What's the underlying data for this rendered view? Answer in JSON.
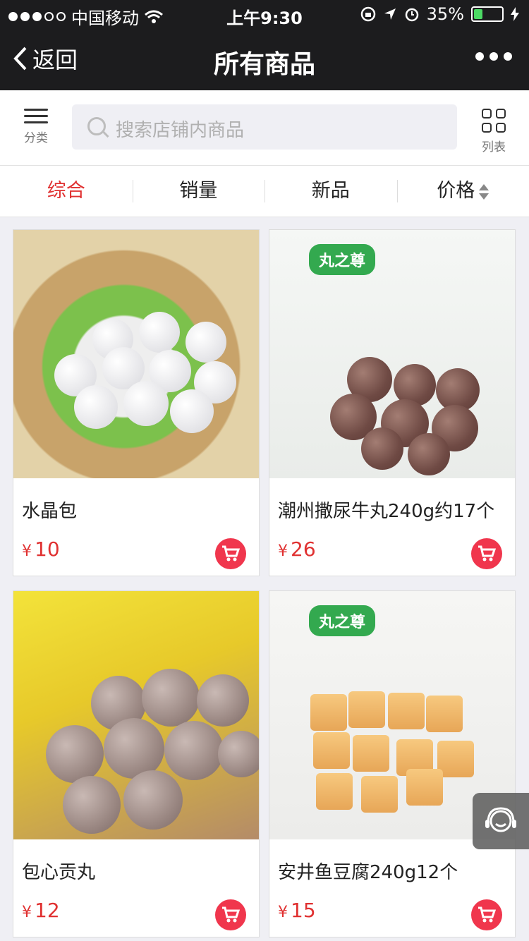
{
  "status_bar": {
    "carrier": "中国移动",
    "time": "上午9:30",
    "battery": "35%",
    "battery_level": 0.35
  },
  "nav": {
    "back_label": "返回",
    "title": "所有商品"
  },
  "toolbar": {
    "category_label": "分类",
    "search_placeholder": "搜索店铺内商品",
    "view_label": "列表"
  },
  "sort_tabs": [
    {
      "label": "综合",
      "active": true
    },
    {
      "label": "销量",
      "active": false
    },
    {
      "label": "新品",
      "active": false
    },
    {
      "label": "价格",
      "active": false
    }
  ],
  "products": [
    {
      "name": "水晶包",
      "currency": "¥",
      "price": "10"
    },
    {
      "name": "潮州撒尿牛丸240g约17个",
      "currency": "¥",
      "price": "26"
    },
    {
      "name": "包心贡丸",
      "currency": "¥",
      "price": "12"
    },
    {
      "name": "安井鱼豆腐240g12个",
      "currency": "¥",
      "price": "15"
    }
  ],
  "packaging_brand": "丸之尊",
  "colors": {
    "accent": "#e03131",
    "cart": "#f0364d",
    "nav_bg": "#1c1c1e"
  }
}
